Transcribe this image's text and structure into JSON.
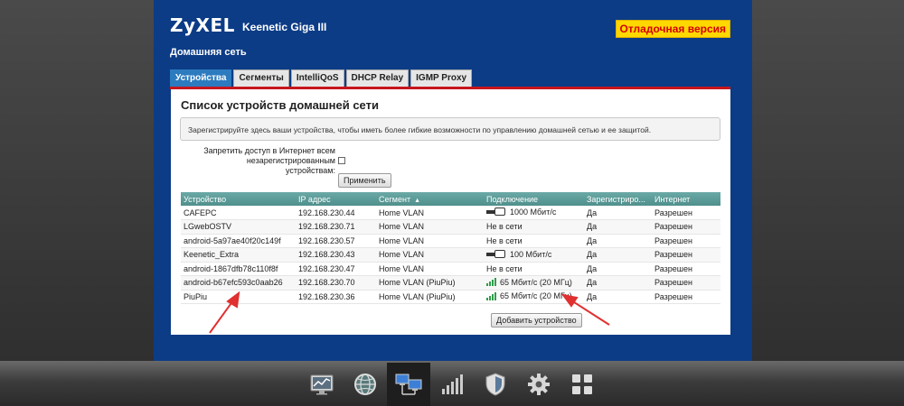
{
  "header": {
    "logo": "ZyXEL",
    "model": "Keenetic Giga III",
    "debug_badge": "Отладочная версия",
    "section_title": "Домашняя сеть"
  },
  "tabs": [
    {
      "label": "Устройства",
      "active": true
    },
    {
      "label": "Сегменты",
      "active": false
    },
    {
      "label": "IntelliQoS",
      "active": false
    },
    {
      "label": "DHCP Relay",
      "active": false
    },
    {
      "label": "IGMP Proxy",
      "active": false
    }
  ],
  "content": {
    "title": "Список устройств домашней сети",
    "info": "Зарегистрируйте здесь ваши устройства, чтобы иметь более гибкие возможности по управлению домашней сетью и ее защитой.",
    "block_label_line1": "Запретить доступ в Интернет всем",
    "block_label_line2": "незарегистрированным устройствам:",
    "block_checked": false,
    "apply_button": "Применить",
    "add_button": "Добавить устройство"
  },
  "table": {
    "columns": [
      "Устройство",
      "IP адрес",
      "Сегмент",
      "Подключение",
      "Зарегистриро...",
      "Интернет"
    ],
    "sorted_column_marker": "▲",
    "rows": [
      {
        "device": "CAFEPC",
        "ip": "192.168.230.44",
        "segment": "Home VLAN",
        "conn_icon": "ethernet-icon",
        "connection": "1000 Мбит/с",
        "registered": "Да",
        "internet": "Разрешен"
      },
      {
        "device": "LGwebOSTV",
        "ip": "192.168.230.71",
        "segment": "Home VLAN",
        "conn_icon": "",
        "connection": "Не в сети",
        "registered": "Да",
        "internet": "Разрешен"
      },
      {
        "device": "android-5a97ae40f20c149f",
        "ip": "192.168.230.57",
        "segment": "Home VLAN",
        "conn_icon": "",
        "connection": "Не в сети",
        "registered": "Да",
        "internet": "Разрешен"
      },
      {
        "device": "Keenetic_Extra",
        "ip": "192.168.230.43",
        "segment": "Home VLAN",
        "conn_icon": "ethernet-icon",
        "connection": "100 Мбит/с",
        "registered": "Да",
        "internet": "Разрешен"
      },
      {
        "device": "android-1867dfb78c110f8f",
        "ip": "192.168.230.47",
        "segment": "Home VLAN",
        "conn_icon": "",
        "connection": "Не в сети",
        "registered": "Да",
        "internet": "Разрешен"
      },
      {
        "device": "android-b67efc593c0aab26",
        "ip": "192.168.230.70",
        "segment": "Home VLAN (PiuPiu)",
        "conn_icon": "wifi-signal-icon",
        "connection": "65 Мбит/с (20 МГц)",
        "registered": "Да",
        "internet": "Разрешен"
      },
      {
        "device": "PiuPiu",
        "ip": "192.168.230.36",
        "segment": "Home VLAN (PiuPiu)",
        "conn_icon": "wifi-signal-icon",
        "connection": "65 Мбит/с (20 МГц)",
        "registered": "Да",
        "internet": "Разрешен"
      }
    ]
  },
  "dock": [
    {
      "icon": "monitor-chart-icon",
      "active": false
    },
    {
      "icon": "globe-icon",
      "active": false
    },
    {
      "icon": "network-computers-icon",
      "active": true
    },
    {
      "icon": "signal-bars-icon",
      "active": false
    },
    {
      "icon": "shield-icon",
      "active": false
    },
    {
      "icon": "gear-icon",
      "active": false
    },
    {
      "icon": "apps-grid-icon",
      "active": false
    }
  ],
  "colors": {
    "brand_blue": "#0c3c86",
    "tab_active": "#2d7bbf",
    "accent_red": "#c8161d",
    "table_header": "#5a9b98",
    "debug_badge_bg": "#ffd800",
    "annotation_arrow": "#e03030"
  }
}
